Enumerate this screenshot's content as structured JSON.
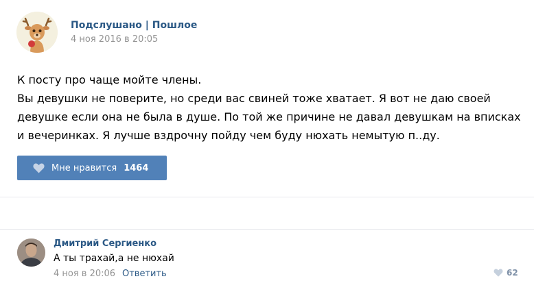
{
  "post": {
    "author": "Подслушано | Пошлое",
    "date": "4 ноя 2016 в 20:05",
    "text_line1": "К посту про чаще мойте члены.",
    "text_line2": "Вы девушки не поверите, но среди вас свиней тоже хватает. Я вот не даю своей девушке если она не была в душе. По той же причине не давал девушкам на вписках и вечеринках. Я лучше вздрочну пойду чем буду нюхать немытую п..ду.",
    "like_label": "Мне нравится",
    "like_count": "1464"
  },
  "comment": {
    "author": "Дмитрий Сергиенко",
    "text": "А ты трахай,а не нюхай",
    "date": "4 ноя в 20:06",
    "reply_label": "Ответить",
    "like_count": "62"
  },
  "icons": {
    "like": "heart-icon",
    "comment_like": "heart-icon"
  },
  "colors": {
    "link": "#2a5885",
    "button": "#5181b8",
    "muted": "#939393"
  }
}
